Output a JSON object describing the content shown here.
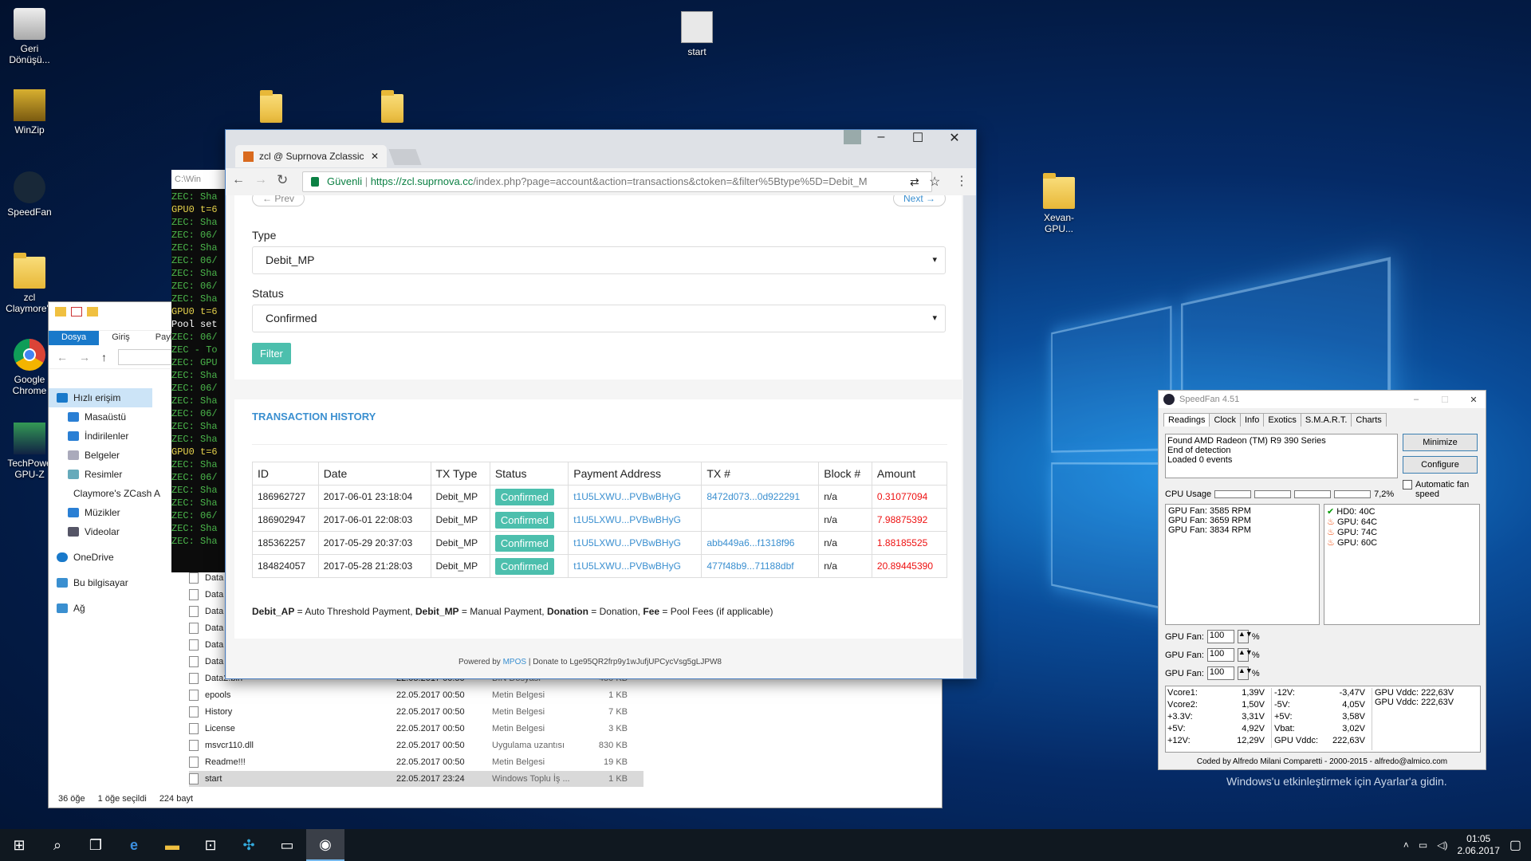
{
  "desktop": {
    "icons": [
      {
        "label": "Geri Dönüşü..."
      },
      {
        "label": "WinZip"
      },
      {
        "label": "SpeedFan"
      },
      {
        "label": "zcl Claymore's"
      },
      {
        "label": "Google Chrome"
      },
      {
        "label": "TechPowe GPU-Z"
      },
      {
        "label": "start"
      },
      {
        "label": "Xevan-GPU..."
      }
    ],
    "activation": "Windows'u etkinleştirmek için Ayarlar'a gidin."
  },
  "taskbar": {
    "time": "01:05",
    "date": "2.06.2017"
  },
  "cmd": {
    "title": "C:\\Win",
    "lines": [
      "ZEC: Sha",
      "GPU0 t=6",
      "ZEC: Sha",
      "ZEC: 06/",
      "ZEC: Sha",
      "ZEC: 06/",
      "ZEC: Sha",
      "ZEC: 06/",
      "ZEC: Sha",
      "GPU0 t=6",
      "Pool set",
      "ZEC: 06/",
      "ZEC - To",
      "ZEC: GPU",
      "ZEC: Sha",
      "ZEC: 06/",
      "ZEC: Sha",
      "ZEC: 06/",
      "ZEC: Sha",
      "ZEC: Sha",
      "GPU0 t=6",
      "ZEC: Sha",
      "ZEC: 06/",
      "ZEC: Sha",
      "ZEC: Sha",
      "ZEC: 06/",
      "ZEC: Sha",
      "ZEC: Sha"
    ]
  },
  "explorer": {
    "ribbon": [
      "Dosya",
      "Giriş",
      "Paylaş"
    ],
    "nav": [
      "Hızlı erişim",
      "Masaüstü",
      "İndirilenler",
      "Belgeler",
      "Resimler",
      "Claymore's ZCash A",
      "Müzikler",
      "Videolar",
      "OneDrive",
      "Bu bilgisayar",
      "Ağ"
    ],
    "partial_files": [
      "Data",
      "Data",
      "Data",
      "Data",
      "Data",
      "Data"
    ],
    "files": [
      {
        "name": "Data2.bin",
        "date": "22.05.2017 00:50",
        "type": "BIN Dosyası",
        "size": "450 KB"
      },
      {
        "name": "epools",
        "date": "22.05.2017 00:50",
        "type": "Metin Belgesi",
        "size": "1 KB"
      },
      {
        "name": "History",
        "date": "22.05.2017 00:50",
        "type": "Metin Belgesi",
        "size": "7 KB"
      },
      {
        "name": "License",
        "date": "22.05.2017 00:50",
        "type": "Metin Belgesi",
        "size": "3 KB"
      },
      {
        "name": "msvcr110.dll",
        "date": "22.05.2017 00:50",
        "type": "Uygulama uzantısı",
        "size": "830 KB"
      },
      {
        "name": "Readme!!!",
        "date": "22.05.2017 00:50",
        "type": "Metin Belgesi",
        "size": "19 KB"
      },
      {
        "name": "start",
        "date": "22.05.2017 23:24",
        "type": "Windows Toplu İş ...",
        "size": "1 KB"
      }
    ],
    "status": {
      "count": "36 öğe",
      "selected": "1 öğe seçildi",
      "size": "224 bayt"
    }
  },
  "chrome": {
    "tab_title": "zcl @ Suprnova Zclassic",
    "secure": "Güvenli",
    "url_host": "https://zcl.suprnova.cc",
    "url_path": "/index.php?page=account&action=transactions&ctoken=&filter%5Btype%5D=Debit_M",
    "prev": "← Prev",
    "next": "Next →",
    "type_label": "Type",
    "type_value": "Debit_MP",
    "status_label": "Status",
    "status_value": "Confirmed",
    "filter_btn": "Filter",
    "history_title": "TRANSACTION HISTORY",
    "columns": [
      "ID",
      "Date",
      "TX Type",
      "Status",
      "Payment Address",
      "TX #",
      "Block #",
      "Amount"
    ],
    "rows": [
      [
        "186962727",
        "2017-06-01 23:18:04",
        "Debit_MP",
        "Confirmed",
        "t1U5LXWU...PVBwBHyG",
        "8472d073...0d922291",
        "n/a",
        "0.31077094"
      ],
      [
        "186902947",
        "2017-06-01 22:08:03",
        "Debit_MP",
        "Confirmed",
        "t1U5LXWU...PVBwBHyG",
        "",
        "n/a",
        "7.98875392"
      ],
      [
        "185362257",
        "2017-05-29 20:37:03",
        "Debit_MP",
        "Confirmed",
        "t1U5LXWU...PVBwBHyG",
        "abb449a6...f1318f96",
        "n/a",
        "1.88185525"
      ],
      [
        "184824057",
        "2017-05-28 21:28:03",
        "Debit_MP",
        "Confirmed",
        "t1U5LXWU...PVBwBHyG",
        "477f48b9...71188dbf",
        "n/a",
        "20.89445390"
      ]
    ],
    "legend": {
      "a_key": "Debit_AP",
      "a_val": " = Auto Threshold Payment, ",
      "b_key": "Debit_MP",
      "b_val": " = Manual Payment, ",
      "c_key": "Donation",
      "c_val": " = Donation, ",
      "d_key": "Fee",
      "d_val": " = Pool Fees (if applicable)"
    },
    "footer_powered": "Powered by ",
    "footer_mpos": "MPOS",
    "footer_donate": " | Donate to Lge95QR2frp9y1wJufjUPCycVsg5gLJPW8"
  },
  "speedfan": {
    "title": "SpeedFan 4.51",
    "tabs": [
      "Readings",
      "Clock",
      "Info",
      "Exotics",
      "S.M.A.R.T.",
      "Charts"
    ],
    "log": [
      "Found AMD Radeon (TM) R9 390 Series",
      "End of detection",
      "Loaded 0 events"
    ],
    "btn_minimize": "Minimize",
    "btn_configure": "Configure",
    "auto_fan": "Automatic fan speed",
    "cpu_usage_label": "CPU Usage",
    "cpu_usage": "7,2%",
    "fans": [
      "GPU Fan: 3585 RPM",
      "GPU Fan: 3659 RPM",
      "GPU Fan: 3834 RPM"
    ],
    "temps": [
      "HD0: 40C",
      "GPU: 64C",
      "GPU: 74C",
      "GPU: 60C"
    ],
    "fan_ctrl": [
      {
        "label": "GPU Fan:",
        "value": "100",
        "unit": "%"
      },
      {
        "label": "GPU Fan:",
        "value": "100",
        "unit": "%"
      },
      {
        "label": "GPU Fan:",
        "value": "100",
        "unit": "%"
      }
    ],
    "volts1": [
      [
        "Vcore1:",
        "1,39V"
      ],
      [
        "Vcore2:",
        "1,50V"
      ],
      [
        "+3.3V:",
        "3,31V"
      ],
      [
        "+5V:",
        "4,92V"
      ],
      [
        "+12V:",
        "12,29V"
      ]
    ],
    "volts2": [
      [
        "-12V:",
        "-3,47V"
      ],
      [
        "-5V:",
        "4,05V"
      ],
      [
        "+5V:",
        "3,58V"
      ],
      [
        "Vbat:",
        "3,02V"
      ],
      [
        "GPU Vddc:",
        "222,63V"
      ]
    ],
    "volts3": [
      "GPU Vddc: 222,63V",
      "GPU Vddc: 222,63V"
    ],
    "footer": "Coded by Alfredo Milani Comparetti - 2000-2015 - alfredo@almico.com"
  }
}
